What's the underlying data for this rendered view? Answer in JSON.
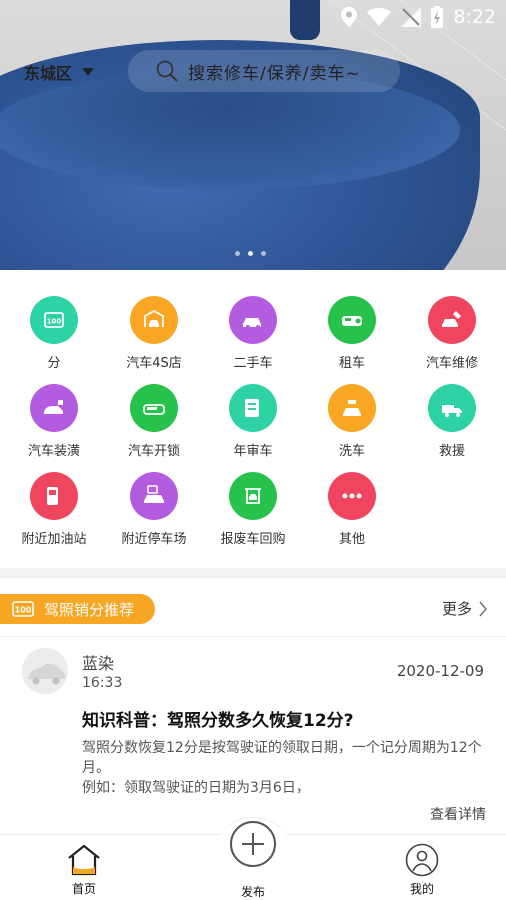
{
  "status_bar": {
    "time": "8:22"
  },
  "header": {
    "location": "东城区",
    "search_placeholder": "搜索修车/保养/卖车~"
  },
  "banner": {
    "dots": 3,
    "active_dot": 1
  },
  "services": [
    {
      "label": "分",
      "icon": "license-100-icon",
      "color": "#2ed3a4"
    },
    {
      "label": "汽车4S店",
      "icon": "car-shop-icon",
      "color": "#f8a623"
    },
    {
      "label": "二手车",
      "icon": "used-car-icon",
      "color": "#b45ce0"
    },
    {
      "label": "租车",
      "icon": "rent-car-icon",
      "color": "#26c24c"
    },
    {
      "label": "汽车维修",
      "icon": "car-repair-icon",
      "color": "#f0455e"
    },
    {
      "label": "汽车装潢",
      "icon": "car-decoration-icon",
      "color": "#b45ce0"
    },
    {
      "label": "汽车开锁",
      "icon": "car-unlock-icon",
      "color": "#26c24c"
    },
    {
      "label": "年审车",
      "icon": "annual-inspection-icon",
      "color": "#2ed3a4"
    },
    {
      "label": "洗车",
      "icon": "car-wash-icon",
      "color": "#f8a623"
    },
    {
      "label": "救援",
      "icon": "rescue-truck-icon",
      "color": "#2ed3a4"
    },
    {
      "label": "附近加油站",
      "icon": "gas-station-icon",
      "color": "#f0455e"
    },
    {
      "label": "附近停车场",
      "icon": "parking-icon",
      "color": "#b45ce0"
    },
    {
      "label": "报废车回购",
      "icon": "scrap-car-icon",
      "color": "#26c24c"
    },
    {
      "label": "其他",
      "icon": "more-dots-icon",
      "color": "#f0455e"
    }
  ],
  "recommend": {
    "tag": "驾照销分推荐",
    "more": "更多",
    "post": {
      "author": "蓝染",
      "time": "16:33",
      "date": "2020-12-09",
      "title": "知识科普：驾照分数多久恢复12分?",
      "body_line1": "驾照分数恢复12分是按驾驶证的领取日期，一个记分周期为12个月。",
      "body_line2": "例如：领取驾驶证的日期为3月6日，",
      "detail": "查看详情"
    }
  },
  "bottom_nav": {
    "home": "首页",
    "publish": "发布",
    "mine": "我的"
  }
}
